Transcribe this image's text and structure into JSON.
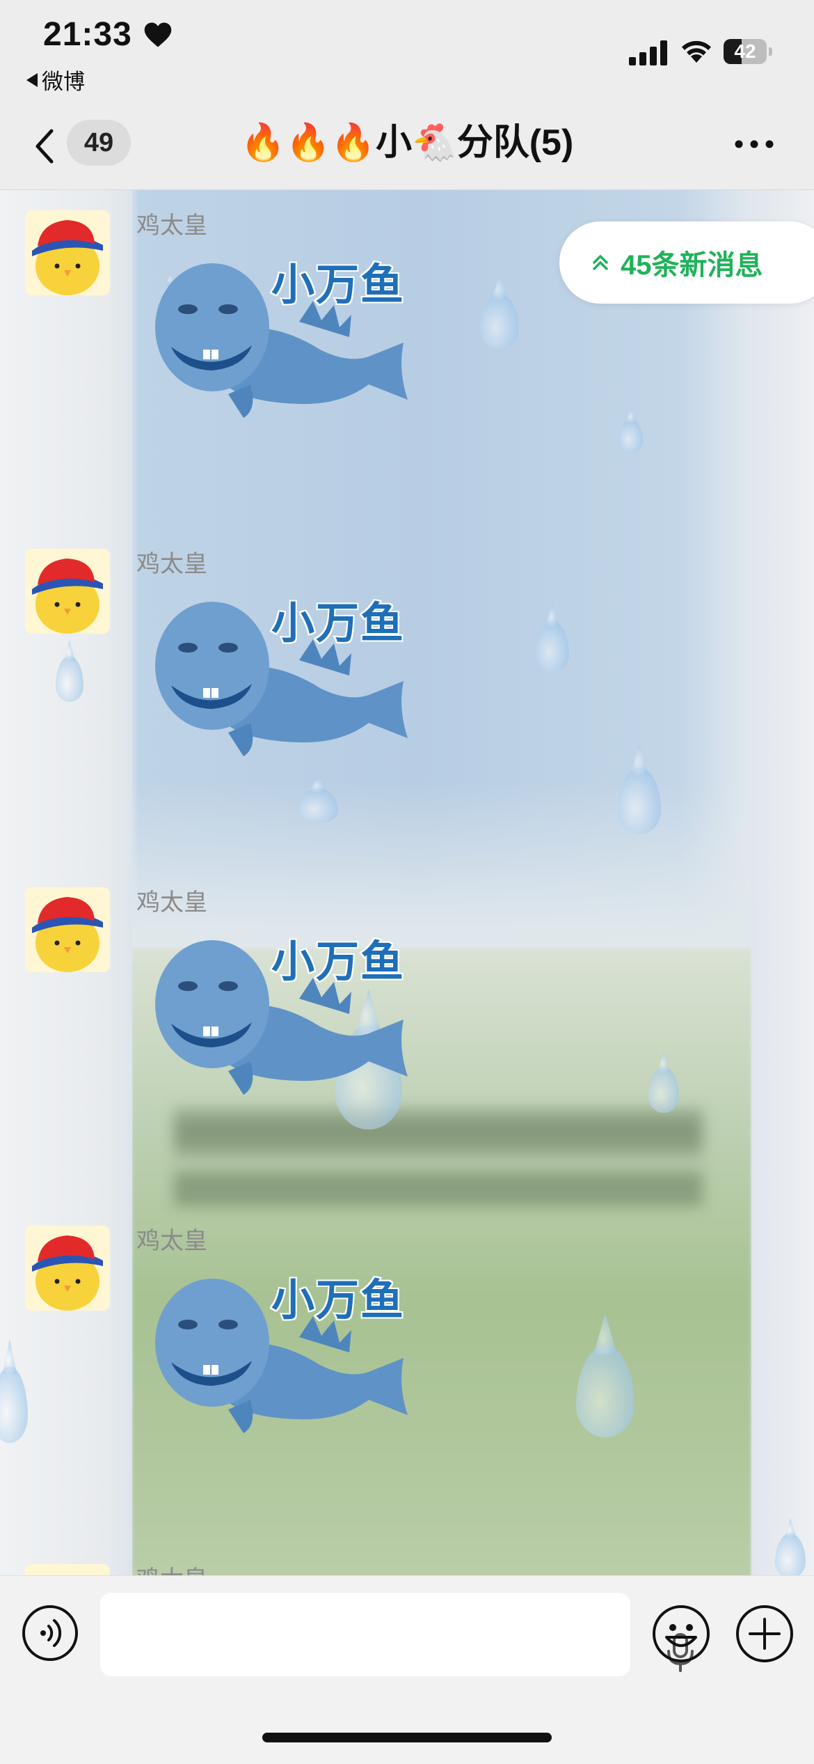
{
  "status_bar": {
    "time": "21:33",
    "back_app": "微博",
    "battery_level": "42",
    "battery_fraction": 0.42,
    "icons": [
      "heart-icon",
      "signal-icon",
      "wifi-icon",
      "battery-icon"
    ]
  },
  "nav": {
    "unread_count": "49",
    "title": "🔥🔥🔥小🐔分队(5)",
    "icons": [
      "back-chevron-icon",
      "more-dots-icon"
    ]
  },
  "new_messages": {
    "label": "45条新消息",
    "icon": "double-chevron-up-icon",
    "color": "#1fb25a"
  },
  "messages": [
    {
      "sender": "鸡太皇",
      "sticker_text": "小万鱼",
      "avatar": "chick-with-red-cap"
    },
    {
      "sender": "鸡太皇",
      "sticker_text": "小万鱼",
      "avatar": "chick-with-red-cap"
    },
    {
      "sender": "鸡太皇",
      "sticker_text": "小万鱼",
      "avatar": "chick-with-red-cap"
    },
    {
      "sender": "鸡太皇",
      "sticker_text": "小万鱼",
      "avatar": "chick-with-red-cap"
    },
    {
      "sender": "鸡太皇",
      "sticker_text": "",
      "avatar": "chick-with-red-cap"
    }
  ],
  "input_bar": {
    "message_value": "",
    "icons": [
      "voice-icon",
      "mic-icon",
      "emoji-icon",
      "plus-icon"
    ]
  }
}
